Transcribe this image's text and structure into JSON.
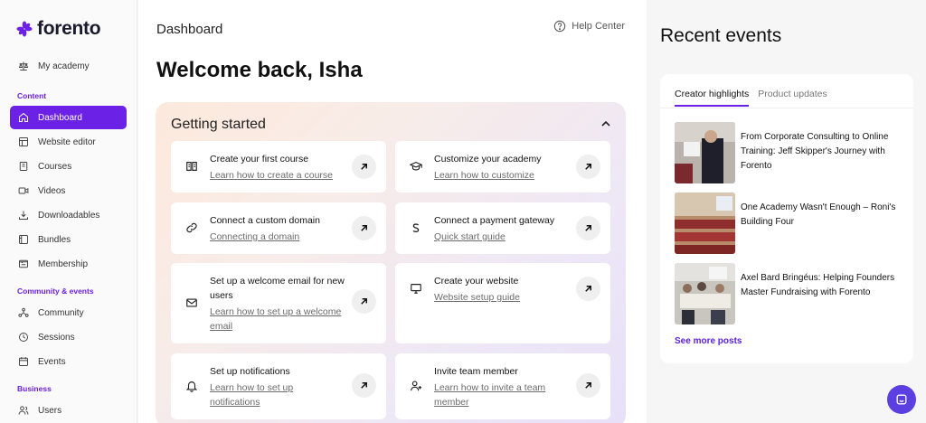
{
  "brand": {
    "name": "forento",
    "color": "#6b21e6"
  },
  "sidebar": {
    "top_item": {
      "label": "My academy",
      "icon": "scale-icon"
    },
    "sections": {
      "content": "Content",
      "community": "Community & events",
      "business": "Business"
    },
    "items": [
      {
        "label": "Dashboard",
        "icon": "home-icon",
        "active": true
      },
      {
        "label": "Website editor",
        "icon": "layout-icon"
      },
      {
        "label": "Courses",
        "icon": "book-icon"
      },
      {
        "label": "Videos",
        "icon": "video-icon"
      },
      {
        "label": "Downloadables",
        "icon": "download-icon"
      },
      {
        "label": "Bundles",
        "icon": "bundle-icon"
      },
      {
        "label": "Membership",
        "icon": "membership-icon"
      },
      {
        "label": "Community",
        "icon": "community-icon"
      },
      {
        "label": "Sessions",
        "icon": "clock-icon"
      },
      {
        "label": "Events",
        "icon": "calendar-icon"
      },
      {
        "label": "Users",
        "icon": "users-icon"
      }
    ]
  },
  "header": {
    "title": "Dashboard",
    "help": "Help Center"
  },
  "welcome": "Welcome back, Isha",
  "getting_started": {
    "title": "Getting started",
    "cards": [
      {
        "title": "Create your first course",
        "link": "Learn how to create a course",
        "icon": "book-open-icon"
      },
      {
        "title": "Customize your academy",
        "link": "Learn how to customize",
        "icon": "graduation-cap-icon"
      },
      {
        "title": "Connect a custom domain",
        "link": "Connecting a domain",
        "icon": "link-icon"
      },
      {
        "title": "Connect a payment gateway",
        "link": "Quick start guide",
        "icon": "stripe-icon"
      },
      {
        "title": "Set up a welcome email for new users",
        "link": "Learn how to set up a welcome email",
        "icon": "mail-icon"
      },
      {
        "title": "Create your website",
        "link": "Website setup guide",
        "icon": "monitor-icon"
      },
      {
        "title": "Set up notifications",
        "link": "Learn how to set up notifications",
        "icon": "bell-icon"
      },
      {
        "title": "Invite team member",
        "link": "Learn how to invite a team member",
        "icon": "user-plus-icon"
      }
    ]
  },
  "recent": {
    "title": "Recent events",
    "tabs": [
      "Creator highlights",
      "Product updates"
    ],
    "posts": [
      {
        "title": "From Corporate Consulting to Online Training: Jeff Skipper's Journey with Forento"
      },
      {
        "title": "One Academy Wasn't Enough – Roni's Building Four"
      },
      {
        "title": "Axel Bard Bringéus: Helping Founders Master Fundraising with Forento"
      }
    ],
    "see_more": "See more posts"
  }
}
